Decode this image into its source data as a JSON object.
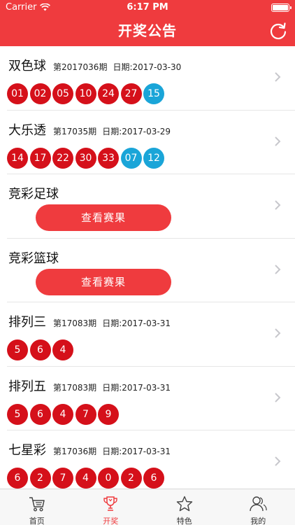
{
  "status_bar": {
    "carrier": "Carrier",
    "time": "6:17 PM"
  },
  "header": {
    "title": "开奖公告"
  },
  "colors": {
    "brand": "#ef3b3e",
    "red_ball": "#d5101a",
    "blue_ball": "#1aa5d8"
  },
  "lotteries": [
    {
      "name": "双色球",
      "issue": "第2017036期",
      "date": "日期:2017-03-30",
      "red": [
        "01",
        "02",
        "05",
        "10",
        "24",
        "27"
      ],
      "blue": [
        "15"
      ]
    },
    {
      "name": "大乐透",
      "issue": "第17035期",
      "date": "日期:2017-03-29",
      "red": [
        "14",
        "17",
        "22",
        "30",
        "33"
      ],
      "blue": [
        "07",
        "12"
      ]
    },
    {
      "name": "竞彩足球",
      "button": "查看赛果"
    },
    {
      "name": "竞彩篮球",
      "button": "查看赛果"
    },
    {
      "name": "排列三",
      "issue": "第17083期",
      "date": "日期:2017-03-31",
      "red": [
        "5",
        "6",
        "4"
      ],
      "blue": []
    },
    {
      "name": "排列五",
      "issue": "第17083期",
      "date": "日期:2017-03-31",
      "red": [
        "5",
        "6",
        "4",
        "7",
        "9"
      ],
      "blue": []
    },
    {
      "name": "七星彩",
      "issue": "第17036期",
      "date": "日期:2017-03-31",
      "red": [
        "6",
        "2",
        "7",
        "4",
        "0",
        "2",
        "6"
      ],
      "blue": []
    }
  ],
  "tabbar": [
    {
      "label": "首页",
      "icon": "cart-icon",
      "active": false
    },
    {
      "label": "开奖",
      "icon": "trophy-icon",
      "active": true
    },
    {
      "label": "特色",
      "icon": "star-icon",
      "active": false
    },
    {
      "label": "我的",
      "icon": "user-icon",
      "active": false
    }
  ]
}
